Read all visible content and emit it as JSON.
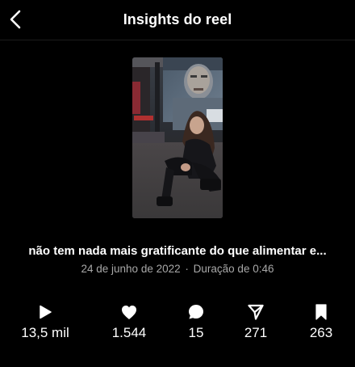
{
  "header": {
    "title": "Insights do reel"
  },
  "reel": {
    "caption": "não tem nada mais gratificante do que alimentar e...",
    "date": "24 de junho de 2022",
    "separator": "·",
    "duration": "Duração de 0:46"
  },
  "stats": [
    {
      "icon": "play-icon",
      "value": "13,5 mil"
    },
    {
      "icon": "heart-icon",
      "value": "1.544"
    },
    {
      "icon": "comment-icon",
      "value": "15"
    },
    {
      "icon": "share-icon",
      "value": "271"
    },
    {
      "icon": "bookmark-icon",
      "value": "263"
    }
  ]
}
